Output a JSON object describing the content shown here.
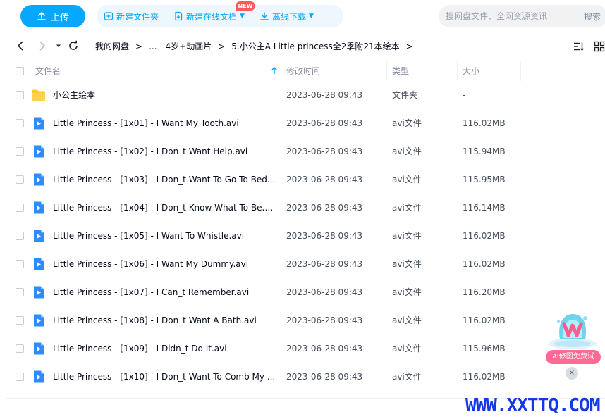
{
  "toolbar": {
    "upload_label": "上传",
    "new_folder_label": "新建文件夹",
    "new_online_doc_label": "新建在线文档",
    "new_badge": "NEW",
    "offline_download_label": "离线下载",
    "search_placeholder": "搜网盘文件、全网资源资讯",
    "search_button": "搜索"
  },
  "breadcrumb": {
    "items": [
      "我的网盘",
      "...",
      "4岁+动画片",
      "5.小公主A Little princess全2季附21本绘本"
    ]
  },
  "table": {
    "headers": {
      "name": "文件名",
      "modified": "修改时间",
      "type": "类型",
      "size": "大小"
    },
    "rows": [
      {
        "name": "小公主绘本",
        "modified": "2023-06-28 09:43",
        "type": "文件夹",
        "size": "-",
        "icon": "folder-icon"
      },
      {
        "name": "Little Princess - [1x01] - I Want My Tooth.avi",
        "modified": "2023-06-28 09:43",
        "type": "avi文件",
        "size": "116.02MB",
        "icon": "video-file-icon"
      },
      {
        "name": "Little Princess - [1x02] - I Don_t Want Help.avi",
        "modified": "2023-06-28 09:43",
        "type": "avi文件",
        "size": "115.94MB",
        "icon": "video-file-icon"
      },
      {
        "name": "Little Princess - [1x03] - I Don_t Want To Go To Bed...",
        "modified": "2023-06-28 09:43",
        "type": "avi文件",
        "size": "115.95MB",
        "icon": "video-file-icon"
      },
      {
        "name": "Little Princess - [1x04] - I Don_t Know What To Be.avi",
        "modified": "2023-06-28 09:43",
        "type": "avi文件",
        "size": "116.14MB",
        "icon": "video-file-icon"
      },
      {
        "name": "Little Princess - [1x05] - I Want To Whistle.avi",
        "modified": "2023-06-28 09:43",
        "type": "avi文件",
        "size": "116.02MB",
        "icon": "video-file-icon"
      },
      {
        "name": "Little Princess - [1x06] - I Want My Dummy.avi",
        "modified": "2023-06-28 09:43",
        "type": "avi文件",
        "size": "116.02MB",
        "icon": "video-file-icon"
      },
      {
        "name": "Little Princess - [1x07] - I Can_t Remember.avi",
        "modified": "2023-06-28 09:43",
        "type": "avi文件",
        "size": "116.20MB",
        "icon": "video-file-icon"
      },
      {
        "name": "Little Princess - [1x08] - I Don_t Want A Bath.avi",
        "modified": "2023-06-28 09:43",
        "type": "avi文件",
        "size": "116.02MB",
        "icon": "video-file-icon"
      },
      {
        "name": "Little Princess - [1x09] - I Didn_t Do It.avi",
        "modified": "2023-06-28 09:43",
        "type": "avi文件",
        "size": "115.96MB",
        "icon": "video-file-icon"
      },
      {
        "name": "Little Princess - [1x10] - I Don_t Want To Comb My ...",
        "modified": "2023-06-28 09:43",
        "type": "avi文件",
        "size": "116.02MB",
        "icon": "video-file-icon"
      }
    ]
  },
  "ai_widget": {
    "label": "AI修图免费试",
    "close": "×"
  },
  "watermark": "WWW.XXTTQ.COM",
  "colors": {
    "accent": "#06a7ff",
    "folder": "#ffc62d",
    "video": "#2f8cff",
    "badge": "#ff5a5a",
    "watermark": "#1438e8"
  }
}
